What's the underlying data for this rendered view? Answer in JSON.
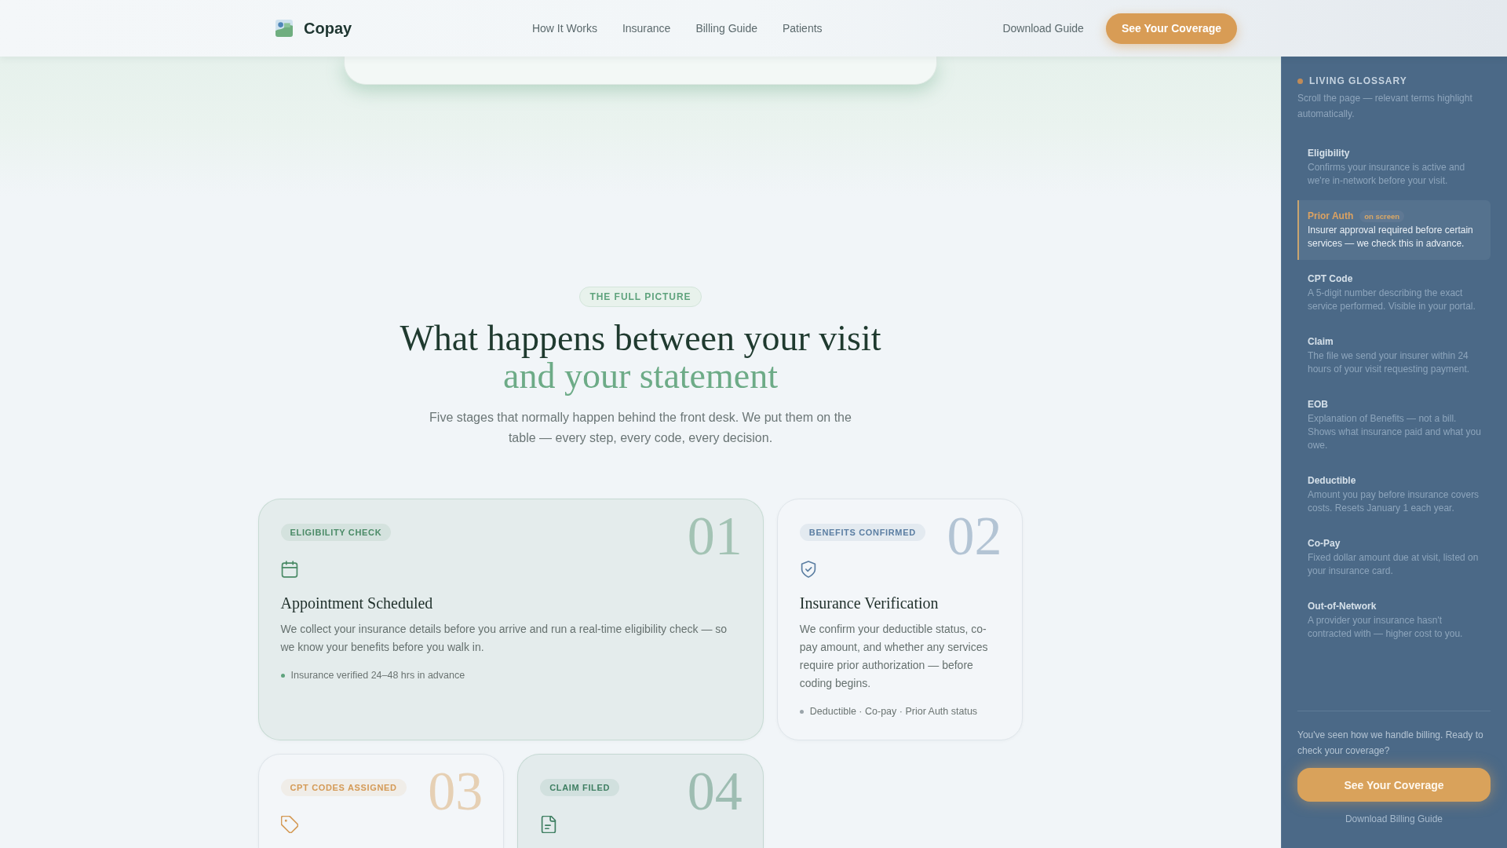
{
  "header": {
    "brand": "Copay",
    "nav": [
      "How It Works",
      "Insurance",
      "Billing Guide",
      "Patients"
    ],
    "link": "Download Guide",
    "cta": "See Your Coverage"
  },
  "intro": {
    "eyebrow": "THE FULL PICTURE",
    "title": "What happens between your visit",
    "title_accent": "and your statement",
    "subtitle": "Five stages that normally happen behind the front desk. We put them on the table — every step, every code, every decision."
  },
  "steps": [
    {
      "badge": "ELIGIBILITY CHECK",
      "number": "01",
      "color": "#4a8a66",
      "highlighted": true,
      "title": "Appointment Scheduled",
      "description": "We collect your insurance details before you arrive and run a real-time eligibility check — so we know your benefits before you walk in.",
      "note": {
        "text": "Insurance verified 24–48 hrs in advance",
        "color": "#5fa37d"
      }
    },
    {
      "badge": "BENEFITS CONFIRMED",
      "number": "02",
      "color": "#5b7ea2",
      "highlighted": false,
      "title": "Insurance Verification",
      "description": "We confirm your deductible status, co-pay amount, and whether any services require prior authorization — before coding begins.",
      "note": {
        "text": "Deductible · Co-pay · Prior Auth status",
        "color": "#9aa4aa"
      }
    },
    {
      "badge": "CPT CODES ASSIGNED",
      "number": "03",
      "color": "#d49a56",
      "highlighted": false
    },
    {
      "badge": "CLAIM FILED",
      "number": "04",
      "color": "#3f7f62",
      "highlighted": true
    }
  ],
  "glossary": {
    "title": "LIVING GLOSSARY",
    "hint": "Scroll the page — relevant terms highlight automatically.",
    "items": [
      {
        "term": "Eligibility",
        "description": "Confirms your insurance is active and we're in-network before your visit.",
        "selected": false
      },
      {
        "term": "Prior Auth",
        "tag": "on screen",
        "description": "Insurer approval required before certain services — we check this in advance.",
        "selected": true
      },
      {
        "term": "CPT Code",
        "description": "A 5-digit number describing the exact service performed. Visible in your portal.",
        "selected": false
      },
      {
        "term": "Claim",
        "description": "The file we send your insurer within 24 hours of your visit requesting payment.",
        "selected": false
      },
      {
        "term": "EOB",
        "description": "Explanation of Benefits — not a bill. Shows what insurance paid and what you owe.",
        "selected": false
      },
      {
        "term": "Deductible",
        "description": "Amount you pay before insurance covers costs. Resets January 1 each year.",
        "selected": false
      },
      {
        "term": "Co-Pay",
        "description": "Fixed dollar amount due at visit, listed on your insurance card.",
        "selected": false
      },
      {
        "term": "Out-of-Network",
        "description": "A provider your insurance hasn't contracted with — higher cost to you.",
        "selected": false
      }
    ],
    "prompt": "You've seen how we handle billing. Ready to check your coverage?",
    "cta": "See Your Coverage",
    "link": "Download Billing Guide"
  }
}
